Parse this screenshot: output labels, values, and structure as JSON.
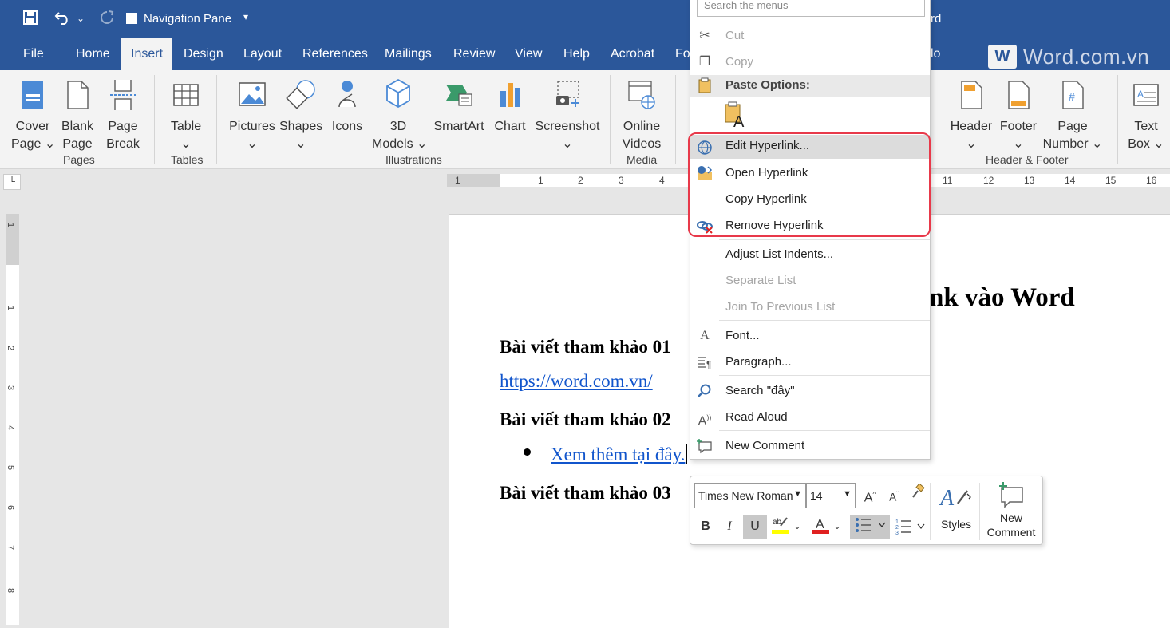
{
  "titlebar": {
    "navigation_pane_label": "Navigation Pane",
    "title_tail": "rd"
  },
  "tabs": [
    {
      "label": "File"
    },
    {
      "label": "Home"
    },
    {
      "label": "Insert"
    },
    {
      "label": "Design"
    },
    {
      "label": "Layout"
    },
    {
      "label": "References"
    },
    {
      "label": "Mailings"
    },
    {
      "label": "Review"
    },
    {
      "label": "View"
    },
    {
      "label": "Help"
    },
    {
      "label": "Acrobat"
    },
    {
      "label": "Fo"
    }
  ],
  "tabs_tail": "lo",
  "active_tab": "Insert",
  "watermark": {
    "text": "Word.com.vn",
    "icon_letter": "W"
  },
  "ribbon": {
    "groups": {
      "pages": "Pages",
      "tables": "Tables",
      "illustrations": "Illustrations",
      "media": "Media",
      "header_footer": "Header & Footer"
    },
    "buttons": {
      "cover_page": [
        "Cover",
        "Page ⌄"
      ],
      "blank_page": [
        "Blank",
        "Page"
      ],
      "page_break": [
        "Page",
        "Break"
      ],
      "table": [
        "Table",
        "⌄"
      ],
      "pictures": [
        "Pictures",
        "⌄"
      ],
      "shapes": [
        "Shapes",
        "⌄"
      ],
      "icons": [
        "Icons",
        ""
      ],
      "models_3d": [
        "3D",
        "Models ⌄"
      ],
      "smartart": [
        "SmartArt",
        ""
      ],
      "chart": [
        "Chart",
        ""
      ],
      "screenshot": [
        "Screenshot",
        "⌄"
      ],
      "online_videos": [
        "Online",
        "Videos"
      ],
      "header": [
        "Header",
        "⌄"
      ],
      "footer": [
        "Footer",
        "⌄"
      ],
      "page_number": [
        "Page",
        "Number ⌄"
      ],
      "text_box": [
        "Text",
        "Box ⌄"
      ]
    }
  },
  "ruler": {
    "h_numbers": [
      "1",
      "1",
      "2",
      "3",
      "4",
      "11",
      "12",
      "13",
      "14",
      "15",
      "16"
    ],
    "v_numbers": [
      "1",
      "1",
      "2",
      "3",
      "4",
      "5",
      "6",
      "7",
      "8"
    ]
  },
  "document": {
    "heading_tail": "nk vào Word",
    "ref1": "Bài viết tham khảo 01",
    "link1": "https://word.com.vn/",
    "ref2": "Bài viết tham khảo 02",
    "bullet_link": "Xem thêm tại đây.",
    "ref3": "Bài viết tham khảo 03"
  },
  "context_menu": {
    "search_placeholder": "Search the menus",
    "cut": "Cut",
    "copy": "Copy",
    "paste_options": "Paste Options:",
    "edit_hyperlink": "Edit Hyperlink...",
    "open_hyperlink": "Open Hyperlink",
    "copy_hyperlink": "Copy Hyperlink",
    "remove_hyperlink": "Remove Hyperlink",
    "adjust_list_indents": "Adjust List Indents...",
    "separate_list": "Separate List",
    "join_previous_list": "Join To Previous List",
    "font": "Font...",
    "paragraph": "Paragraph...",
    "search": "Search \"đây\"",
    "read_aloud": "Read Aloud",
    "new_comment": "New Comment"
  },
  "mini_toolbar": {
    "font_name": "Times New Roman",
    "font_size": "14",
    "styles_label": "Styles",
    "new_comment_label": [
      "New",
      "Comment"
    ]
  },
  "colors": {
    "accent": "#2b579a",
    "highlight_box": "#e8394a",
    "link": "#1155cc"
  }
}
